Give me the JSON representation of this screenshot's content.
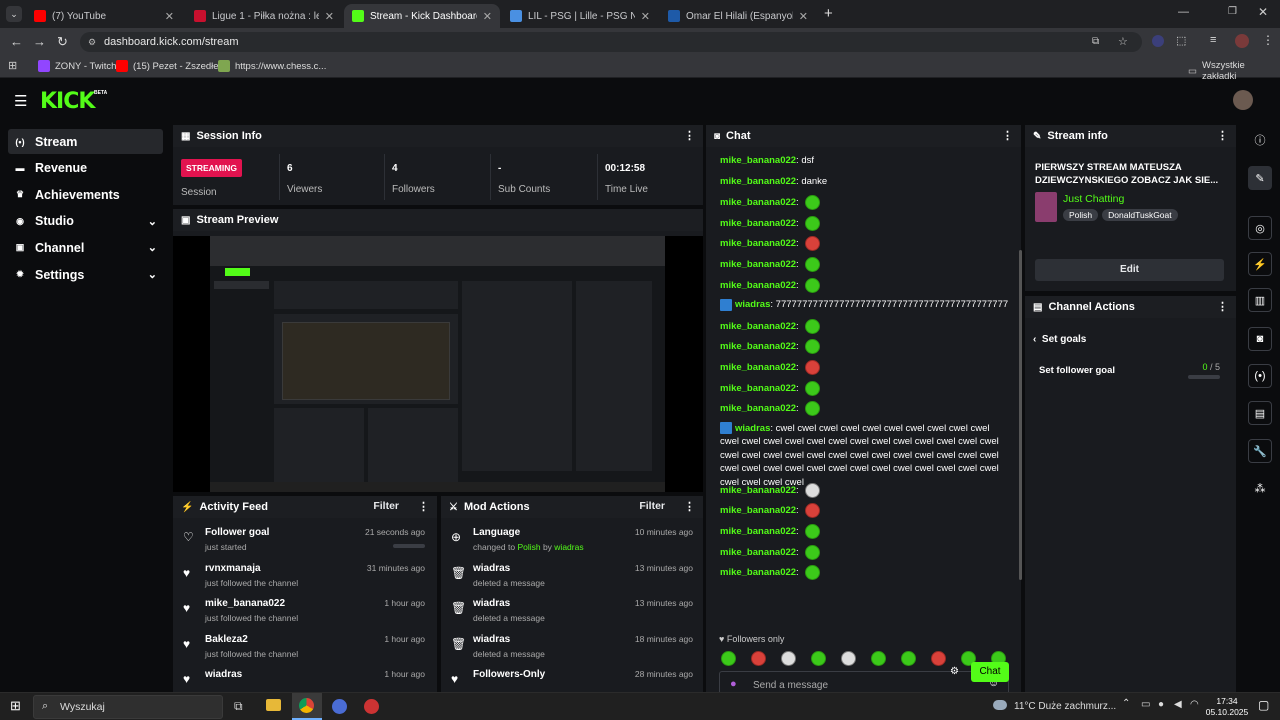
{
  "browser": {
    "tabs": [
      {
        "label": "(7) YouTube",
        "color": "#ff0000"
      },
      {
        "label": "Ligue 1 - Piłka nożna : legalny k",
        "color": "#c8102e"
      },
      {
        "label": "Stream - Kick Dashboard",
        "color": "#53fc18",
        "active": true
      },
      {
        "label": "LIL - PSG | Lille - PSG NA ŻYWO",
        "color": "#4a90e2"
      },
      {
        "label": "Omar El Hilali (Espanyol) statyst",
        "color": "#1e5aa8"
      }
    ],
    "url": "dashboard.kick.com/stream",
    "bookmarks": [
      "ZONY - Twitch",
      "(15) Pezet - Zszedłe...",
      "https://www.chess.c..."
    ],
    "all_bookmarks": "Wszystkie zakładki"
  },
  "kick": {
    "logo": "KICK",
    "beta": "BETA",
    "sidebar": [
      {
        "label": "Stream",
        "icon": "broadcast-icon",
        "glyph": "(•)",
        "active": true
      },
      {
        "label": "Revenue",
        "icon": "revenue-icon",
        "glyph": "▬"
      },
      {
        "label": "Achievements",
        "icon": "trophy-icon",
        "glyph": "♛"
      },
      {
        "label": "Studio",
        "icon": "studio-icon",
        "glyph": "◉",
        "chevron": true
      },
      {
        "label": "Channel",
        "icon": "channel-icon",
        "glyph": "▣",
        "chevron": true
      },
      {
        "label": "Settings",
        "icon": "gear-icon",
        "glyph": "✹",
        "chevron": true
      }
    ],
    "session": {
      "title": "Session Info",
      "badge": "STREAMING",
      "badge_label": "Session",
      "stats": [
        {
          "value": "6",
          "label": "Viewers"
        },
        {
          "value": "4",
          "label": "Followers"
        },
        {
          "value": "-",
          "label": "Sub Counts"
        },
        {
          "value": "00:12:58",
          "label": "Time Live"
        }
      ]
    },
    "preview_title": "Stream Preview",
    "activity": {
      "title": "Activity Feed",
      "filter": "Filter",
      "items": [
        {
          "title": "Follower goal",
          "sub": "just started",
          "time": "21 seconds ago"
        },
        {
          "title": "rvnxmanaja",
          "sub": "just followed the channel",
          "time": "31 minutes ago"
        },
        {
          "title": "mike_banana022",
          "sub": "just followed the channel",
          "time": "1 hour ago"
        },
        {
          "title": "Bakleza2",
          "sub": "just followed the channel",
          "time": "1 hour ago"
        },
        {
          "title": "wiadras",
          "sub": "",
          "time": "1 hour ago"
        }
      ]
    },
    "mod": {
      "title": "Mod Actions",
      "filter": "Filter",
      "items": [
        {
          "title": "Language",
          "sub_pre": "changed to ",
          "sub_a": "Polish",
          "sub_mid": " by ",
          "sub_b": "wiadras",
          "time": "10 minutes ago",
          "icon": "globe-icon"
        },
        {
          "title": "wiadras",
          "sub": "deleted a message",
          "time": "13 minutes ago",
          "icon": "trash-icon"
        },
        {
          "title": "wiadras",
          "sub": "deleted a message",
          "time": "13 minutes ago",
          "icon": "trash-icon"
        },
        {
          "title": "wiadras",
          "sub": "deleted a message",
          "time": "18 minutes ago",
          "icon": "trash-icon"
        },
        {
          "title": "Followers-Only",
          "sub": "",
          "time": "28 minutes ago",
          "icon": "heart-icon"
        }
      ]
    },
    "chat": {
      "title": "Chat",
      "messages": [
        {
          "user": "mike_banana022",
          "text": "dsf"
        },
        {
          "user": "mike_banana022",
          "text": "danke"
        },
        {
          "user": "mike_banana022",
          "emote": "green"
        },
        {
          "user": "mike_banana022",
          "emote": "green"
        },
        {
          "user": "mike_banana022",
          "emote": "red"
        },
        {
          "user": "mike_banana022",
          "emote": "green"
        },
        {
          "user": "mike_banana022",
          "emote": "green"
        },
        {
          "user": "wiadras",
          "text": "77777777777777777777777777777777777777777777"
        },
        {
          "user": "mike_banana022",
          "emote": "green"
        },
        {
          "user": "mike_banana022",
          "emote": "green"
        },
        {
          "user": "mike_banana022",
          "emote": "red"
        },
        {
          "user": "mike_banana022",
          "emote": "green"
        },
        {
          "user": "mike_banana022",
          "emote": "green"
        },
        {
          "user": "wiadras",
          "text": "cwel cwel cwel cwel cwel cwel cwel cwel cwel cwel cwel cwel cwel cwel cwel cwel cwel cwel cwel cwel cwel cwel cwel cwel cwel cwel cwel cwel cwel cwel cwel cwel cwel cwel cwel cwel cwel cwel cwel cwel cwel cwel cwel cwel cwel cwel cwel cwel cwel cwel cwel cwel cwel"
        },
        {
          "user": "mike_banana022",
          "emote": "white"
        },
        {
          "user": "mike_banana022",
          "emote": "red"
        },
        {
          "user": "mike_banana022",
          "emote": "green"
        },
        {
          "user": "mike_banana022",
          "emote": "green"
        },
        {
          "user": "mike_banana022",
          "emote": "green"
        }
      ],
      "followers_only": "Followers only",
      "input_placeholder": "Send a message",
      "send": "Chat"
    },
    "stream_info": {
      "title": "Stream info",
      "stream_title": "PIERWSZY STREAM MATEUSZA DZIEWCZYNSKIEGO ZOBACZ JAK SIE...",
      "category": "Just Chatting",
      "tags": [
        "Polish",
        "DonaldTuskGoat"
      ],
      "edit": "Edit"
    },
    "channel_actions": {
      "title": "Channel Actions",
      "back": "Set goals",
      "goal_label": "Set follower goal",
      "goal_value": "0",
      "goal_total": "/ 5",
      "goal_fraction": 0
    }
  },
  "taskbar": {
    "search": "Wyszukaj",
    "weather": "11°C  Duże zachmurz...",
    "time": "17:34",
    "date": "05.10.2025"
  }
}
